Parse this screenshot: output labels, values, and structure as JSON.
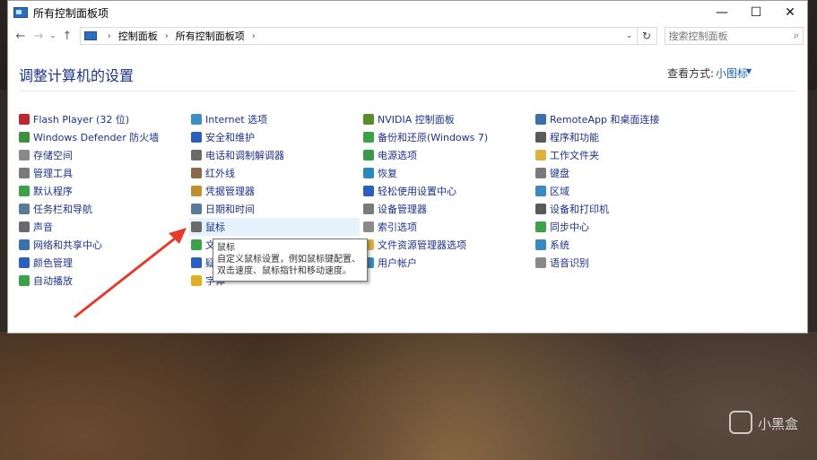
{
  "window": {
    "title": "所有控制面板项",
    "controls": {
      "minimize": "—",
      "maximize": "☐",
      "close": "✕"
    }
  },
  "nav": {
    "back": "←",
    "forward": "→",
    "dropdown": "⌄",
    "up": "↑"
  },
  "breadcrumb": [
    "控制面板",
    "所有控制面板项"
  ],
  "search": {
    "placeholder": "搜索控制面板"
  },
  "heading": "调整计算机的设置",
  "view_by": {
    "label": "查看方式:",
    "value": "小图标"
  },
  "columns": [
    [
      {
        "label": "Flash Player (32 位)",
        "icon": "flash-icon",
        "color": "#c0262d"
      },
      {
        "label": "Windows Defender 防火墙",
        "icon": "firewall-icon",
        "color": "#3e8f3e"
      },
      {
        "label": "存储空间",
        "icon": "storage-icon",
        "color": "#8a8a8a"
      },
      {
        "label": "管理工具",
        "icon": "admin-tools-icon",
        "color": "#7a7a7a"
      },
      {
        "label": "默认程序",
        "icon": "default-programs-icon",
        "color": "#3aa34a"
      },
      {
        "label": "任务栏和导航",
        "icon": "taskbar-icon",
        "color": "#5a7a9a"
      },
      {
        "label": "声音",
        "icon": "sound-icon",
        "color": "#6a6a6a"
      },
      {
        "label": "网络和共享中心",
        "icon": "network-icon",
        "color": "#3a6fb0"
      },
      {
        "label": "颜色管理",
        "icon": "color-management-icon",
        "color": "#2a5fbf"
      },
      {
        "label": "自动播放",
        "icon": "autoplay-icon",
        "color": "#3aa34a"
      }
    ],
    [
      {
        "label": "Internet 选项",
        "icon": "internet-options-icon",
        "color": "#3a8fc8"
      },
      {
        "label": "安全和维护",
        "icon": "security-flag-icon",
        "color": "#2a5fbf"
      },
      {
        "label": "电话和调制解调器",
        "icon": "phone-modem-icon",
        "color": "#6a6a6a"
      },
      {
        "label": "红外线",
        "icon": "infrared-icon",
        "color": "#8a6a4a"
      },
      {
        "label": "凭据管理器",
        "icon": "credential-icon",
        "color": "#c09030"
      },
      {
        "label": "日期和时间",
        "icon": "clock-icon",
        "color": "#5a7a9a"
      },
      {
        "label": "鼠标",
        "icon": "mouse-icon",
        "color": "#6a6a6a"
      },
      {
        "label": "文件历史记录",
        "icon": "file-history-icon",
        "color": "#3aa34a"
      },
      {
        "label": "疑难解答",
        "icon": "troubleshoot-icon",
        "color": "#2a5fbf"
      },
      {
        "label": "字体",
        "icon": "fonts-icon",
        "color": "#e0b020"
      }
    ],
    [
      {
        "label": "NVIDIA 控制面板",
        "icon": "nvidia-icon",
        "color": "#5a8a2a"
      },
      {
        "label": "备份和还原(Windows 7)",
        "icon": "backup-icon",
        "color": "#3aa34a"
      },
      {
        "label": "电源选项",
        "icon": "power-icon",
        "color": "#3a9a4a"
      },
      {
        "label": "恢复",
        "icon": "recovery-icon",
        "color": "#2a8ac0"
      },
      {
        "label": "轻松使用设置中心",
        "icon": "ease-of-access-icon",
        "color": "#2a5fbf"
      },
      {
        "label": "设备管理器",
        "icon": "device-manager-icon",
        "color": "#7a7a7a"
      },
      {
        "label": "索引选项",
        "icon": "indexing-icon",
        "color": "#8a8a8a"
      },
      {
        "label": "文件资源管理器选项",
        "icon": "folder-options-icon",
        "color": "#e0b040"
      },
      {
        "label": "用户帐户",
        "icon": "user-accounts-icon",
        "color": "#3a8ac0"
      }
    ],
    [
      {
        "label": "RemoteApp 和桌面连接",
        "icon": "remoteapp-icon",
        "color": "#3a6fb0"
      },
      {
        "label": "程序和功能",
        "icon": "programs-icon",
        "color": "#5a5a5a"
      },
      {
        "label": "工作文件夹",
        "icon": "work-folders-icon",
        "color": "#e0b040"
      },
      {
        "label": "键盘",
        "icon": "keyboard-icon",
        "color": "#7a7a7a"
      },
      {
        "label": "区域",
        "icon": "region-icon",
        "color": "#3a8ac0"
      },
      {
        "label": "设备和打印机",
        "icon": "printer-icon",
        "color": "#5a5a5a"
      },
      {
        "label": "同步中心",
        "icon": "sync-icon",
        "color": "#3aa34a"
      },
      {
        "label": "系统",
        "icon": "system-icon",
        "color": "#3a8ac0"
      },
      {
        "label": "语音识别",
        "icon": "microphone-icon",
        "color": "#8a8a8a"
      }
    ]
  ],
  "tooltip": {
    "title": "鼠标",
    "line1": "自定义鼠标设置，例如鼠标键配置、",
    "line2": "双击速度、鼠标指针和移动速度。"
  },
  "watermark": "小黑盒",
  "accent_color": "#1e3287",
  "arrow_color": "#e53b2c"
}
